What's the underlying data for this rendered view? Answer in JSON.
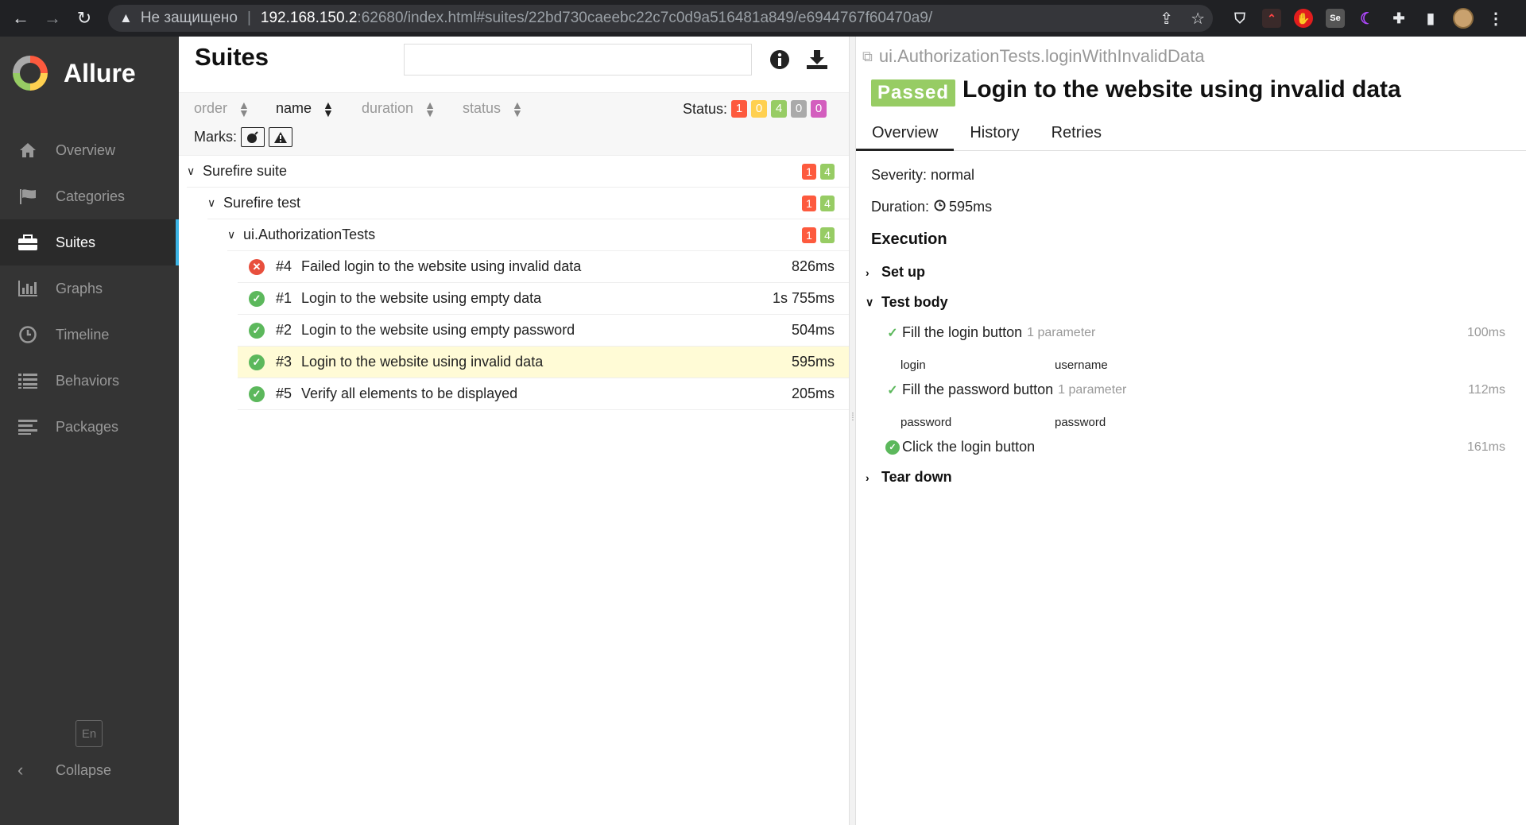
{
  "browser": {
    "insecure_label": "Не защищено",
    "url_host": "192.168.150.2",
    "url_rest": ":62680/index.html#suites/22bd730caeebc22c7c0d9a516481a849/e6944767f60470a9/"
  },
  "sidebar": {
    "brand": "Allure",
    "items": [
      {
        "label": "Overview",
        "icon": "home-icon"
      },
      {
        "label": "Categories",
        "icon": "flag-icon"
      },
      {
        "label": "Suites",
        "icon": "briefcase-icon",
        "active": true
      },
      {
        "label": "Graphs",
        "icon": "bar-chart-icon"
      },
      {
        "label": "Timeline",
        "icon": "clock-icon"
      },
      {
        "label": "Behaviors",
        "icon": "list-icon"
      },
      {
        "label": "Packages",
        "icon": "align-left-icon"
      }
    ],
    "lang": "En",
    "collapse": "Collapse"
  },
  "suites": {
    "title": "Suites",
    "search_placeholder": "",
    "sort": {
      "order": "order",
      "name": "name",
      "duration": "duration",
      "status": "status"
    },
    "status_label": "Status:",
    "status_counts": {
      "failed": "1",
      "broken": "0",
      "passed": "4",
      "skipped": "0",
      "unknown": "0"
    },
    "marks_label": "Marks:",
    "tree": {
      "suite": {
        "name": "Surefire suite",
        "failed": "1",
        "passed": "4"
      },
      "test": {
        "name": "Surefire test",
        "failed": "1",
        "passed": "4"
      },
      "class": {
        "name": "ui.AuthorizationTests",
        "failed": "1",
        "passed": "4"
      }
    },
    "cases": [
      {
        "order": "#4",
        "name": "Failed login to the website using invalid data",
        "duration": "826ms",
        "status": "failed"
      },
      {
        "order": "#1",
        "name": "Login to the website using empty data",
        "duration": "1s 755ms",
        "status": "passed"
      },
      {
        "order": "#2",
        "name": "Login to the website using empty password",
        "duration": "504ms",
        "status": "passed"
      },
      {
        "order": "#3",
        "name": "Login to the website using invalid data",
        "duration": "595ms",
        "status": "passed",
        "selected": true
      },
      {
        "order": "#5",
        "name": "Verify all elements to be displayed",
        "duration": "205ms",
        "status": "passed"
      }
    ]
  },
  "details": {
    "full_name": "ui.AuthorizationTests.loginWithInvalidData",
    "status_badge": "Passed",
    "title": "Login to the website using invalid data",
    "tabs": [
      "Overview",
      "History",
      "Retries"
    ],
    "severity": "Severity: normal",
    "duration_label": "Duration:",
    "duration_value": "595ms",
    "execution_header": "Execution",
    "setup": "Set up",
    "test_body": "Test body",
    "teardown": "Tear down",
    "steps": [
      {
        "name": "Fill the login button",
        "param_count": "1 parameter",
        "duration": "100ms",
        "param_name": "login",
        "param_value": "username"
      },
      {
        "name": "Fill the password button",
        "param_count": "1 parameter",
        "duration": "112ms",
        "param_name": "password",
        "param_value": "password"
      },
      {
        "name": "Click the login button",
        "param_count": "",
        "duration": "161ms"
      }
    ]
  }
}
